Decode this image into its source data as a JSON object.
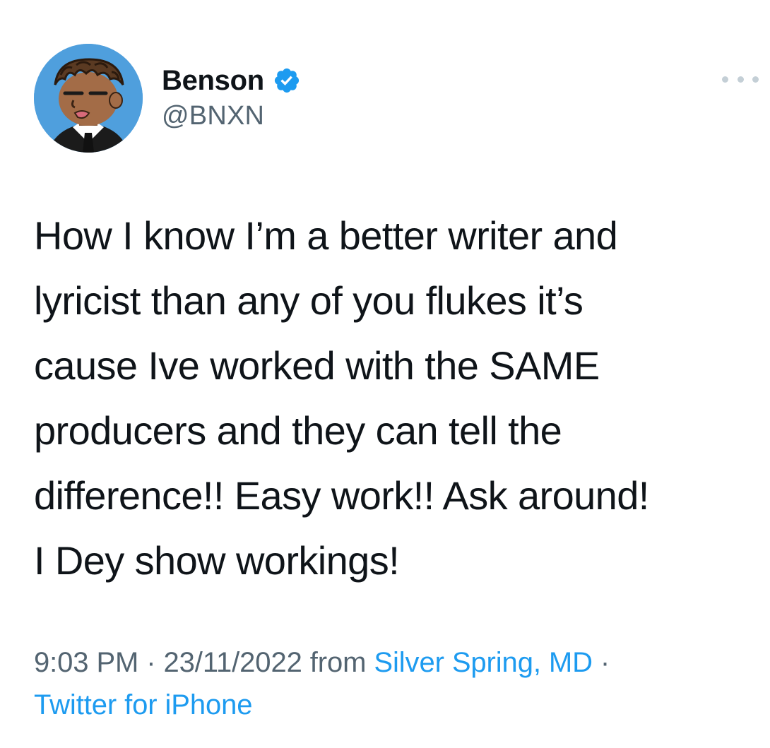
{
  "author": {
    "display_name": "Benson",
    "handle": "@BNXN",
    "verified": true,
    "avatar_icon": "cartoon-avatar-icon"
  },
  "tweet": {
    "text": "How I know I’m a better writer and\nlyricist than any of you flukes it’s\ncause Ive worked with the SAME\nproducers and they can tell the\ndifference!! Easy work!! Ask around!\nI Dey show workings!"
  },
  "meta": {
    "time": "9:03 PM",
    "separator": " · ",
    "date": "23/11/2022",
    "from_label": " from ",
    "location": "Silver Spring, MD",
    "separator2": " · ",
    "source": "Twitter for iPhone"
  },
  "colors": {
    "link": "#1d9bf0",
    "secondary_text": "#536471",
    "verified_badge": "#1d9bf0",
    "avatar_background": "#4f9fdd"
  }
}
